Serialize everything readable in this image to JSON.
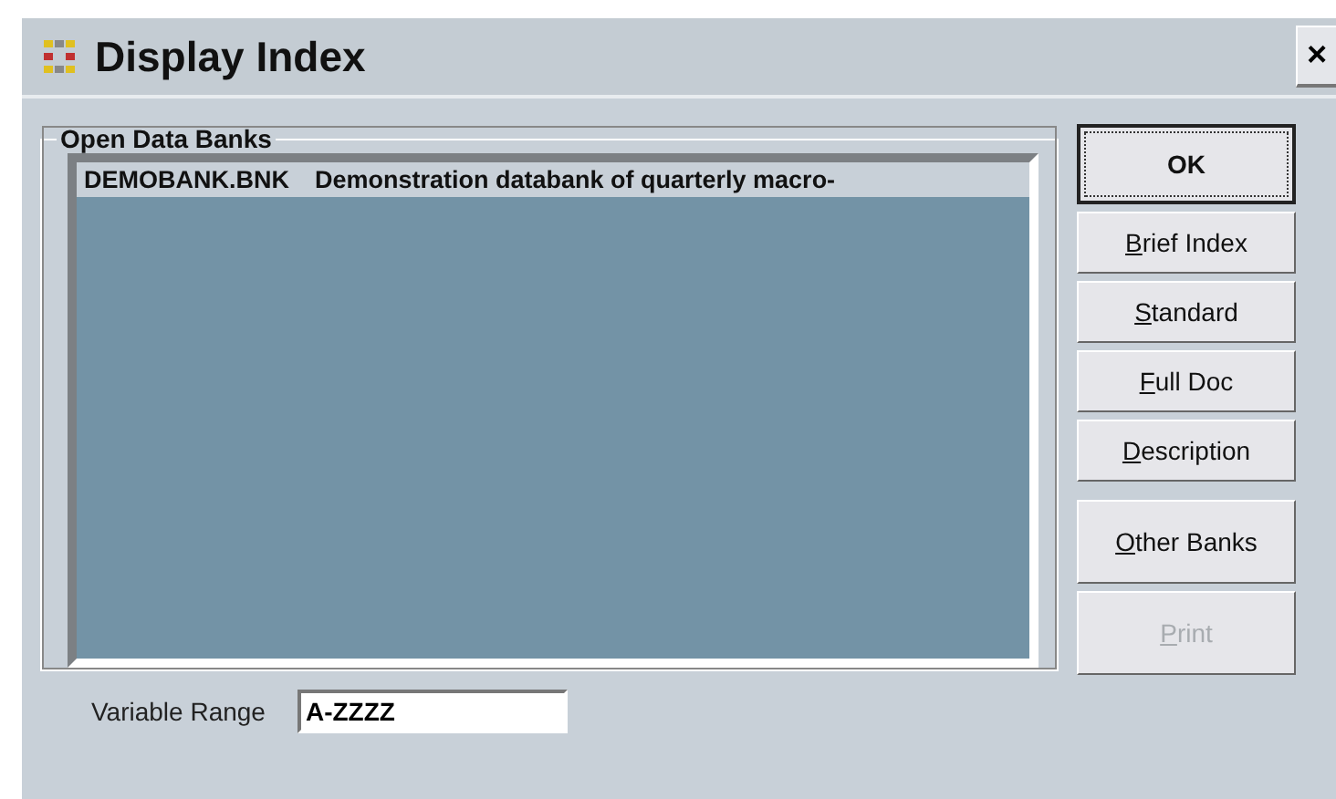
{
  "window": {
    "title": "Display Index",
    "close": "×"
  },
  "group": {
    "label": "Open Data Banks",
    "banks": [
      {
        "file": "DEMOBANK.BNK",
        "description": "Demonstration databank of quarterly macro-",
        "selected": true
      }
    ]
  },
  "buttons": [
    {
      "label": "OK",
      "default": true,
      "disabled": false
    },
    {
      "label": "Brief Index",
      "default": false,
      "disabled": false
    },
    {
      "label": "Standard",
      "default": false,
      "disabled": false
    },
    {
      "label": "Full Doc",
      "default": false,
      "disabled": false
    },
    {
      "label": "Description",
      "default": false,
      "disabled": false
    },
    {
      "label": "Other Banks",
      "default": false,
      "disabled": false
    },
    {
      "label": "Print",
      "default": false,
      "disabled": true
    }
  ],
  "variable_range": {
    "label": "Variable Range",
    "value": "A-ZZZZ"
  }
}
